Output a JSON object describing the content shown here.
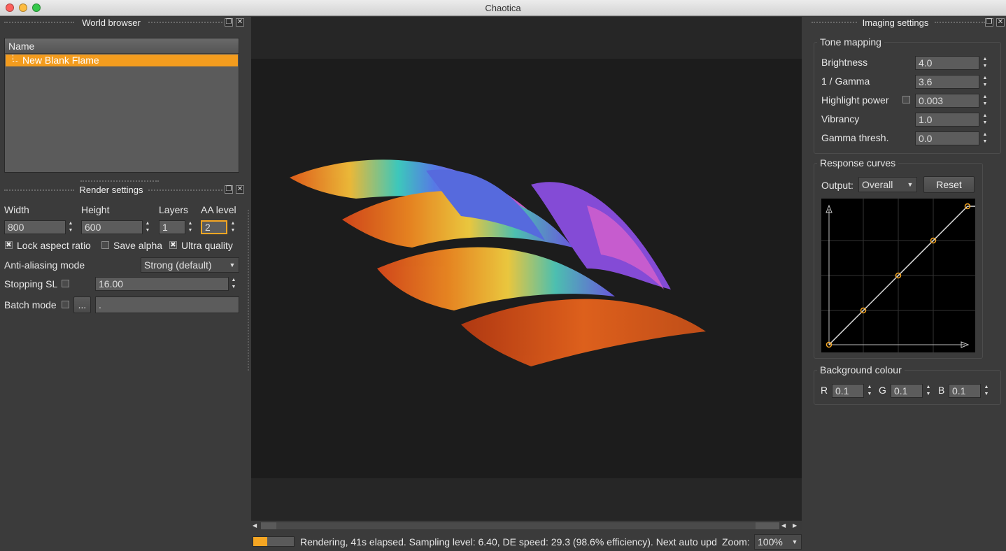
{
  "window": {
    "title": "Chaotica"
  },
  "world_browser": {
    "title": "World browser",
    "column": "Name",
    "item": "New Blank Flame",
    "float_glyph": "❐",
    "close_glyph": "✕"
  },
  "render_settings": {
    "title": "Render settings",
    "width_label": "Width",
    "width": "800",
    "height_label": "Height",
    "height": "600",
    "layers_label": "Layers",
    "layers": "1",
    "aa_label": "AA level",
    "aa": "2",
    "lock_label": "Lock aspect ratio",
    "lock_checked": true,
    "alpha_label": "Save alpha",
    "alpha_checked": false,
    "ultra_label": "Ultra quality",
    "ultra_checked": true,
    "aa_mode_label": "Anti-aliasing mode",
    "aa_mode": "Strong (default)",
    "stop_label": "Stopping SL",
    "stop_value": "16.00",
    "batch_label": "Batch mode",
    "batch_button": "...",
    "batch_path": "."
  },
  "imaging": {
    "title": "Imaging settings",
    "tone_title": "Tone mapping",
    "brightness_label": "Brightness",
    "brightness": "4.0",
    "gamma_label": "1 / Gamma",
    "gamma": "3.6",
    "highlight_label": "Highlight power",
    "highlight": "0.003",
    "vibrancy_label": "Vibrancy",
    "vibrancy": "1.0",
    "gthresh_label": "Gamma thresh.",
    "gthresh": "0.0",
    "curves_title": "Response curves",
    "output_label": "Output:",
    "output": "Overall",
    "reset": "Reset",
    "bg_title": "Background colour",
    "r_label": "R",
    "r": "0.1",
    "g_label": "G",
    "g": "0.1",
    "b_label": "B",
    "b": "0.1"
  },
  "status": {
    "text": "Rendering, 41s elapsed. Sampling level: 6.40, DE speed: 29.3 (98.6% efficiency). Next auto upd",
    "progress": 0.35,
    "zoom_label": "Zoom:",
    "zoom": "100%"
  },
  "colors": {
    "accent": "#f5a623",
    "selection": "#f39c1e",
    "canvas": "#1c1c1c"
  },
  "icons": {
    "check": "✖",
    "up": "▲",
    "down": "▼",
    "combo": "▼",
    "scroll_left": "◀",
    "scroll_right": "▶"
  }
}
